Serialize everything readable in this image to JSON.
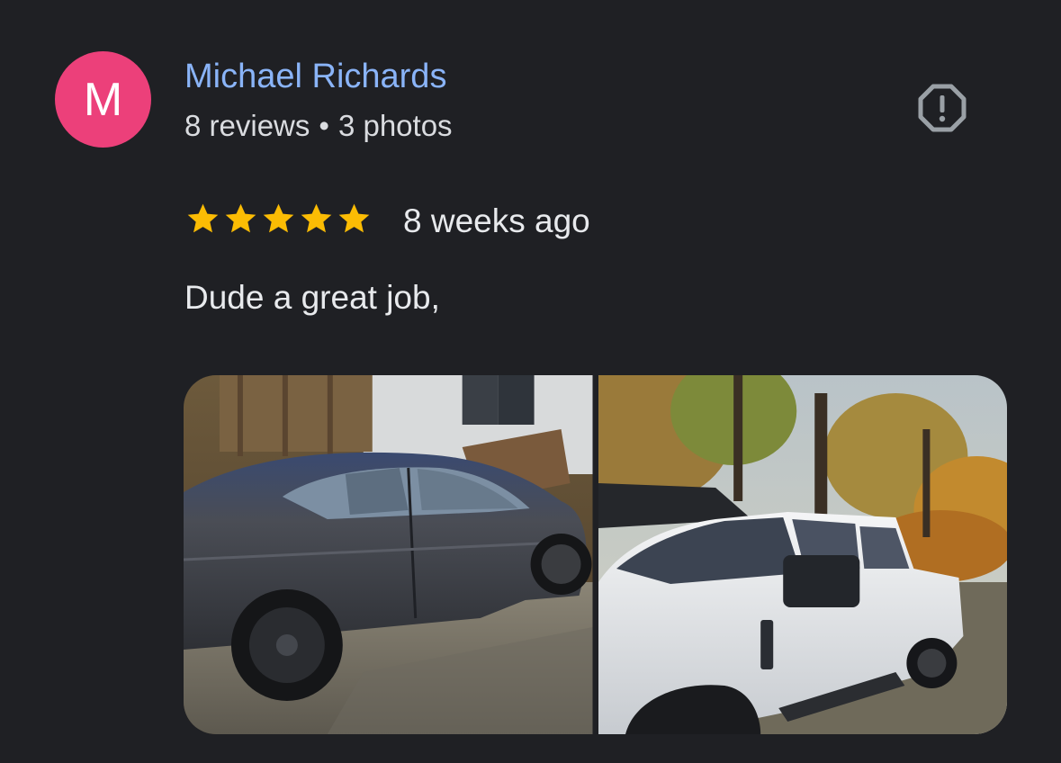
{
  "review": {
    "author": {
      "initial": "M",
      "name": "Michael Richards",
      "reviews": "8 reviews",
      "separator": "•",
      "photos": "3 photos",
      "avatar_color": "#ec407a",
      "name_color": "#8ab4f8"
    },
    "rating": 5,
    "rating_max": 5,
    "star_color": "#fbbc04",
    "date": "8 weeks ago",
    "text": "Dude a great job,",
    "report_icon": "report-octagon-icon",
    "photos": [
      {
        "subject": "dark-gray-sedan"
      },
      {
        "subject": "white-pickup-truck"
      }
    ]
  }
}
